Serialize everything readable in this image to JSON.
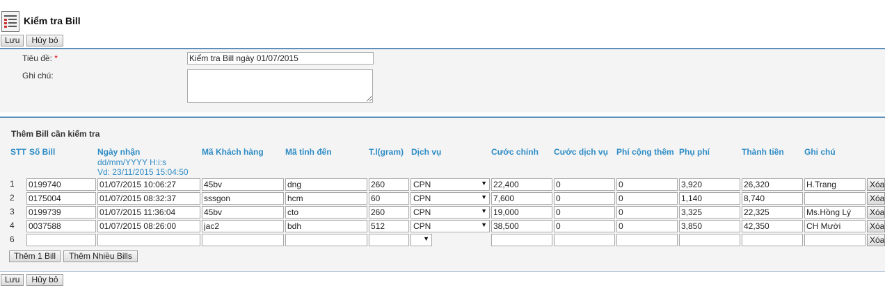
{
  "header": {
    "title": "Kiểm tra Bill",
    "icon": "checklist-icon"
  },
  "toolbar": {
    "save_label": "Lưu",
    "cancel_label": "Hủy bỏ"
  },
  "form": {
    "title_label": "Tiêu đề:",
    "required_mark": "*",
    "title_value": "Kiểm tra Bill ngày 01/07/2015",
    "note_label": "Ghi chú:",
    "note_value": ""
  },
  "bills": {
    "section_title": "Thêm Bill cần kiểm tra",
    "columns": {
      "stt": "STT",
      "bill_no": "Số Bill",
      "received_date": "Ngày nhận",
      "date_hint_format": "dd/mm/YYYY H:i:s",
      "date_hint_example": "Vd: 23/11/2015 15:04:50",
      "customer_code": "Mã Khách hàng",
      "province_code": "Mã tỉnh đến",
      "weight": "T.l(gram)",
      "service": "Dịch vụ",
      "main_fee": "Cước chính",
      "service_fee": "Cước dịch vụ",
      "extra_fee": "Phí cộng thêm",
      "surcharge": "Phụ phí",
      "total": "Thành tiền",
      "note": "Ghi chú"
    },
    "rows": [
      {
        "stt": "1",
        "bill": "0199740",
        "date": "01/07/2015 10:06:27",
        "customer": "45bv",
        "province": "dng",
        "weight": "260",
        "service": "CPN",
        "main_fee": "22,400",
        "service_fee": "0",
        "extra_fee": "0",
        "surcharge": "3,920",
        "total": "26,320",
        "note": "H.Trang",
        "delete": "Xóa"
      },
      {
        "stt": "2",
        "bill": "0175004",
        "date": "01/07/2015 08:32:37",
        "customer": "sssgon",
        "province": "hcm",
        "weight": "60",
        "service": "CPN",
        "main_fee": "7,600",
        "service_fee": "0",
        "extra_fee": "0",
        "surcharge": "1,140",
        "total": "8,740",
        "note": "",
        "delete": "Xóa"
      },
      {
        "stt": "3",
        "bill": "0199739",
        "date": "01/07/2015 11:36:04",
        "customer": "45bv",
        "province": "cto",
        "weight": "260",
        "service": "CPN",
        "main_fee": "19,000",
        "service_fee": "0",
        "extra_fee": "0",
        "surcharge": "3,325",
        "total": "22,325",
        "note": "Ms.Hồng Lý",
        "delete": "Xóa"
      },
      {
        "stt": "4",
        "bill": "0037588",
        "date": "01/07/2015 08:26:00",
        "customer": "jac2",
        "province": "bdh",
        "weight": "512",
        "service": "CPN",
        "main_fee": "38,500",
        "service_fee": "0",
        "extra_fee": "0",
        "surcharge": "3,850",
        "total": "42,350",
        "note": "CH Mười",
        "delete": "Xóa"
      },
      {
        "stt": "6",
        "bill": "",
        "date": "",
        "customer": "",
        "province": "",
        "weight": "",
        "service": "",
        "main_fee": "",
        "service_fee": "",
        "extra_fee": "",
        "surcharge": "",
        "total": "",
        "note": "",
        "delete": "Xóa"
      }
    ],
    "add_one_label": "Thêm 1 Bill",
    "add_many_label": "Thêm Nhiều Bills"
  }
}
